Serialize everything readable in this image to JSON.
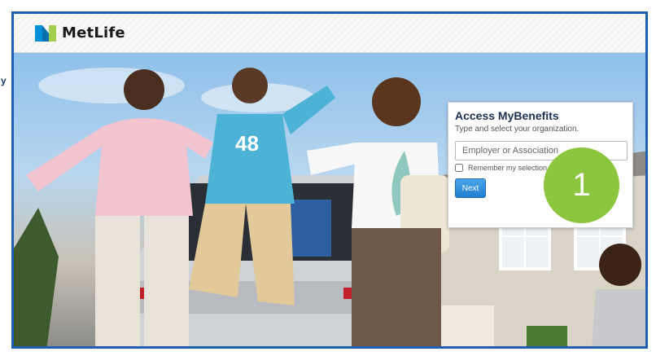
{
  "side_fragment": "y",
  "header": {
    "brand_name": "MetLife",
    "brand_colors": {
      "blue": "#0090da",
      "green": "#a4ce4e"
    }
  },
  "login_card": {
    "title": "Access MyBenefits",
    "subtitle": "Type and select your organization.",
    "input_placeholder": "Employer or Association",
    "input_value": "",
    "remember_label": "Remember my selection",
    "remember_checked": false,
    "next_label": "Next"
  },
  "step_badge": {
    "label": "1",
    "color": "#8cc63f"
  },
  "hero": {
    "icon": "family-photo",
    "jersey_number": "48"
  },
  "colors": {
    "frame_border": "#1f5fb0",
    "button_blue": "#1f7fd0",
    "title_navy": "#1c3152"
  }
}
